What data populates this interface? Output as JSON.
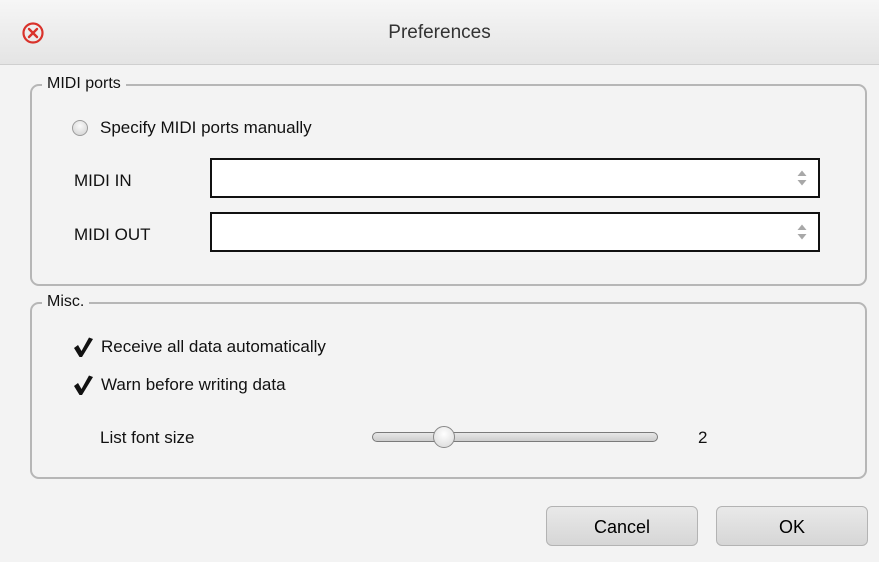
{
  "window": {
    "title": "Preferences",
    "close_icon": "close-circle-icon",
    "close_color": "#d9322b"
  },
  "midi_ports": {
    "group_label": "MIDI ports",
    "manual_radio": {
      "label": "Specify MIDI ports manually",
      "selected": false
    },
    "midi_in": {
      "label": "MIDI IN",
      "value": ""
    },
    "midi_out": {
      "label": "MIDI OUT",
      "value": ""
    }
  },
  "misc": {
    "group_label": "Misc.",
    "receive_all": {
      "label": "Receive all data automatically",
      "checked": true
    },
    "warn_before_writing": {
      "label": "Warn before writing data",
      "checked": true
    },
    "list_font_size": {
      "label": "List font size",
      "value": "2",
      "slider_fraction": 0.25
    }
  },
  "buttons": {
    "cancel": "Cancel",
    "ok": "OK"
  }
}
